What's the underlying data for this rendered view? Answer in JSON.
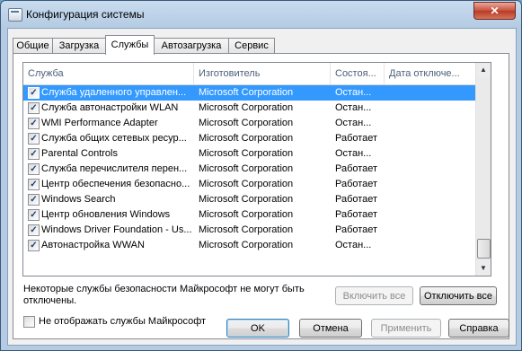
{
  "window": {
    "title": "Конфигурация системы",
    "close_glyph": "✕"
  },
  "tabs": [
    {
      "label": "Общие"
    },
    {
      "label": "Загрузка"
    },
    {
      "label": "Службы",
      "active": true
    },
    {
      "label": "Автозагрузка"
    },
    {
      "label": "Сервис"
    }
  ],
  "services": {
    "columns": [
      "Служба",
      "Изготовитель",
      "Состоя...",
      "Дата отключе..."
    ],
    "rows": [
      {
        "checked": true,
        "name": "Служба удаленного управлен...",
        "vendor": "Microsoft Corporation",
        "status": "Остан...",
        "date": "",
        "selected": true
      },
      {
        "checked": true,
        "name": "Служба автонастройки WLAN",
        "vendor": "Microsoft Corporation",
        "status": "Остан...",
        "date": ""
      },
      {
        "checked": true,
        "name": "WMI Performance Adapter",
        "vendor": "Microsoft Corporation",
        "status": "Остан...",
        "date": ""
      },
      {
        "checked": true,
        "name": "Служба общих сетевых ресур...",
        "vendor": "Microsoft Corporation",
        "status": "Работает",
        "date": ""
      },
      {
        "checked": true,
        "name": "Parental Controls",
        "vendor": "Microsoft Corporation",
        "status": "Остан...",
        "date": ""
      },
      {
        "checked": true,
        "name": "Служба перечислителя перен...",
        "vendor": "Microsoft Corporation",
        "status": "Работает",
        "date": ""
      },
      {
        "checked": true,
        "name": "Центр обеспечения безопасно...",
        "vendor": "Microsoft Corporation",
        "status": "Работает",
        "date": ""
      },
      {
        "checked": true,
        "name": "Windows Search",
        "vendor": "Microsoft Corporation",
        "status": "Работает",
        "date": ""
      },
      {
        "checked": true,
        "name": "Центр обновления Windows",
        "vendor": "Microsoft Corporation",
        "status": "Работает",
        "date": ""
      },
      {
        "checked": true,
        "name": "Windows Driver Foundation - Us...",
        "vendor": "Microsoft Corporation",
        "status": "Работает",
        "date": ""
      },
      {
        "checked": true,
        "name": "Автонастройка WWAN",
        "vendor": "Microsoft Corporation",
        "status": "Остан...",
        "date": ""
      }
    ]
  },
  "note": "Некоторые службы безопасности Майкрософт не могут быть отключены.",
  "buttons": {
    "enable_all": "Включить все",
    "disable_all": "Отключить все",
    "ok": "OK",
    "cancel": "Отмена",
    "apply": "Применить",
    "help": "Справка"
  },
  "hide_ms_label": "Не отображать службы Майкрософт",
  "check_glyph": "✓",
  "colors": {
    "selection": "#3399ff",
    "title_bar": "#b4cbe3",
    "close_button": "#c8503c"
  }
}
